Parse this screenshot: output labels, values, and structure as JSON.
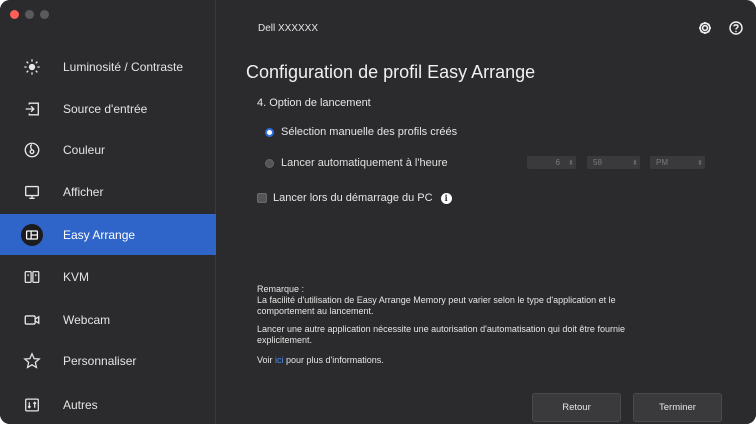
{
  "window": {
    "traffic_lights": [
      "#ff5f57",
      "#5a5a5c",
      "#5a5a5c"
    ],
    "title": "Dell XXXXXX"
  },
  "sidebar": {
    "items": [
      {
        "label": "Luminosité / Contraste",
        "icon": "sun-icon"
      },
      {
        "label": "Source d'entrée",
        "icon": "input-source-icon"
      },
      {
        "label": "Couleur",
        "icon": "color-icon"
      },
      {
        "label": "Afficher",
        "icon": "monitor-icon"
      },
      {
        "label": "Easy Arrange",
        "icon": "easy-arrange-icon",
        "active": true
      },
      {
        "label": "KVM",
        "icon": "kvm-icon"
      },
      {
        "label": "Webcam",
        "icon": "webcam-icon"
      },
      {
        "label": "Personnaliser",
        "icon": "star-icon"
      },
      {
        "label": "Autres",
        "icon": "others-icon"
      }
    ]
  },
  "header": {
    "settings_icon": "gear-icon",
    "help_icon": "help-icon"
  },
  "main": {
    "title": "Configuration de profil Easy Arrange",
    "section": "4. Option de lancement",
    "option_manual": "Sélection manuelle des profils créés",
    "option_auto": "Lancer automatiquement à l'heure",
    "time": {
      "hour": "6",
      "minute": "58",
      "ampm": "PM"
    },
    "startup_checkbox": "Lancer lors du démarrage du PC",
    "note_title": "Remarque :",
    "note_line1": "La facilité d'utilisation de Easy Arrange Memory peut varier selon le type d'application et le",
    "note_line2": "comportement au lancement.",
    "note_line3": "Lancer une autre application nécessite une autorisation d'automatisation qui doit être fournie",
    "note_line4": "explicitement.",
    "note_link_prefix": "Voir ",
    "note_link": "ici",
    "note_link_suffix": " pour plus d'informations.",
    "back_button": "Retour",
    "finish_button": "Terminer"
  },
  "colors": {
    "accent": "#2f64c8",
    "background": "#2b2b2d",
    "link": "#4d8df0"
  }
}
